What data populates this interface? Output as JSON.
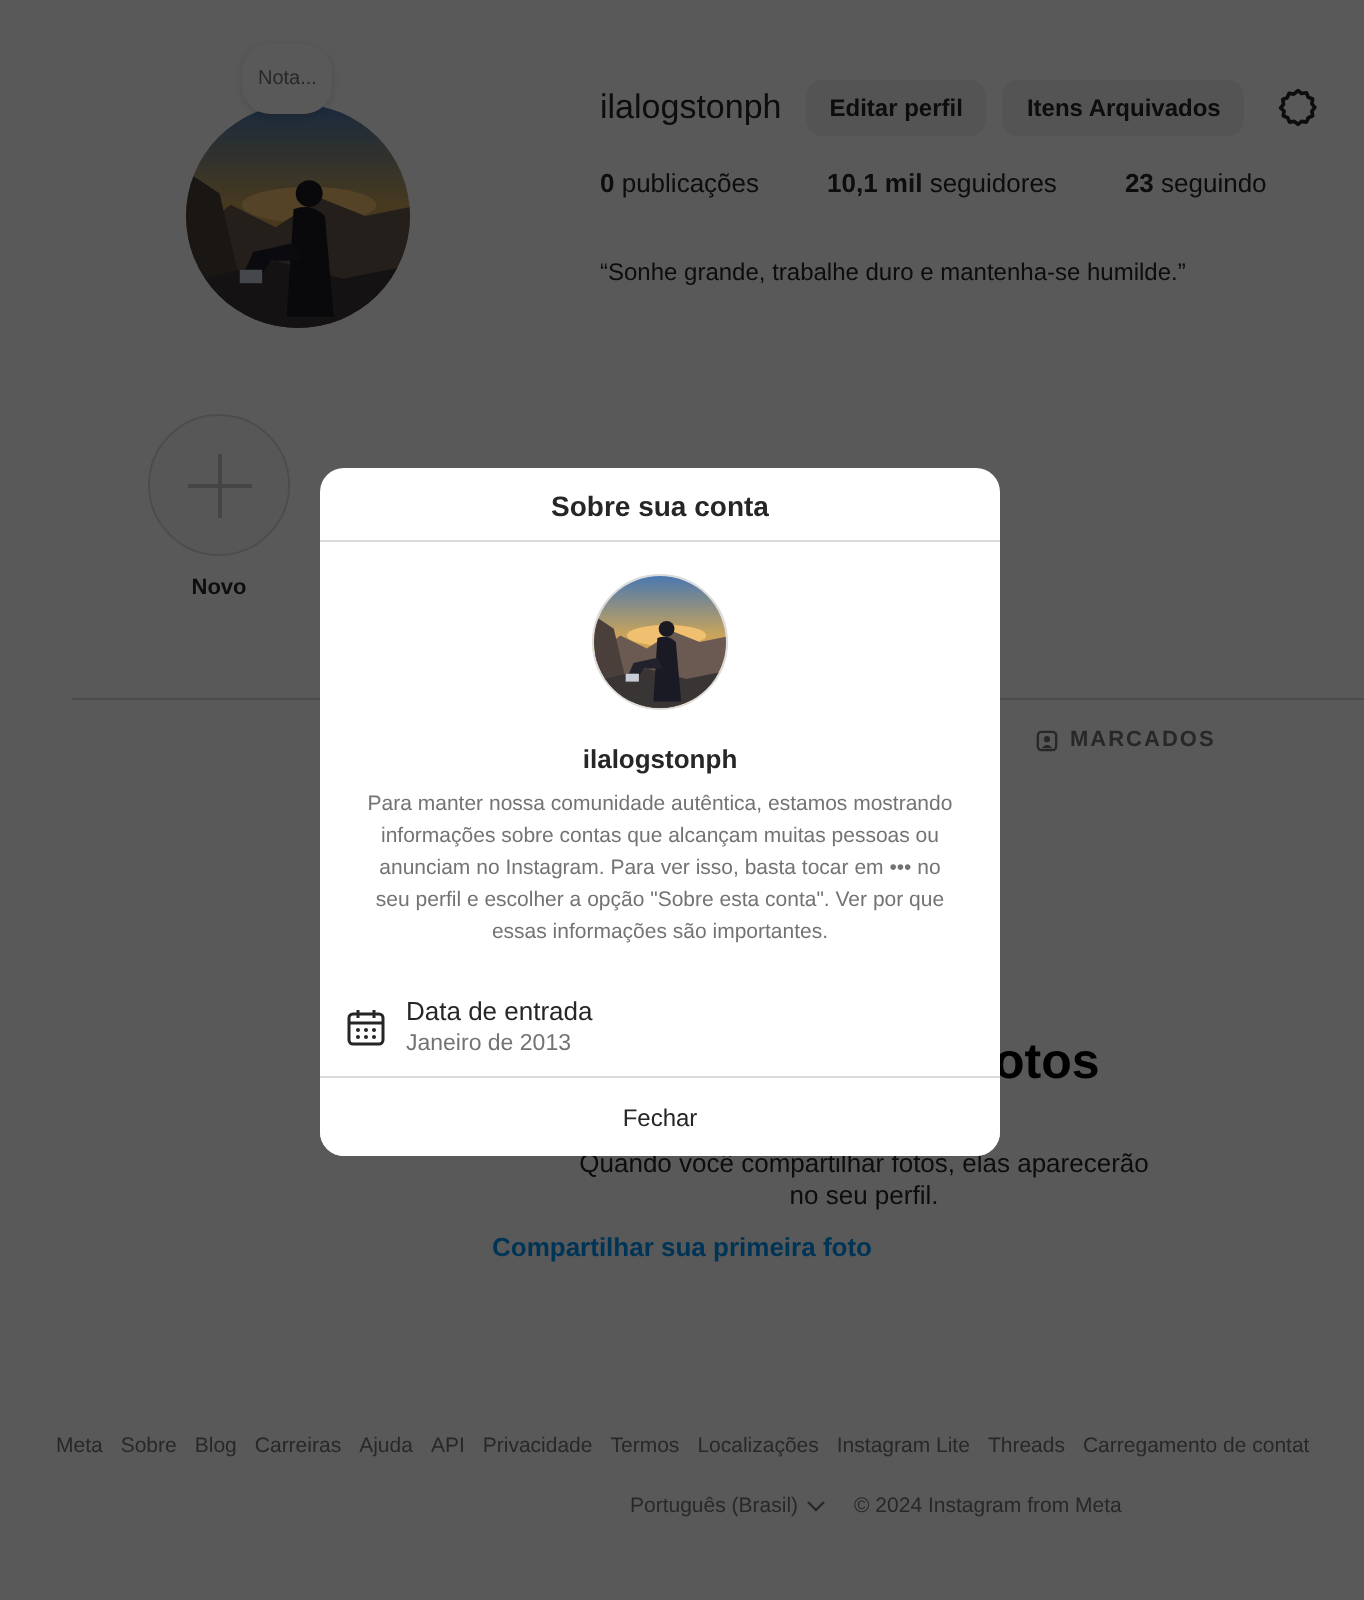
{
  "profile": {
    "note": "Nota...",
    "username": "ilalogstonph",
    "buttons": [
      "Editar perfil",
      "Itens Arquivados"
    ],
    "stats": [
      "**0** publicações",
      "**10,1 mil** seguidores",
      "**23** seguindo"
    ],
    "bio": "“Sonhe grande, trabalhe duro e mantenha-se humilde.”"
  },
  "highlights": [
    {
      "label": "Novo"
    }
  ],
  "tabs": [
    {
      "label": "MARCADOS"
    }
  ],
  "empty_state": {
    "title": "otos",
    "text": "Quando você compartilhar fotos, elas aparecerão no seu perfil.",
    "link": "Compartilhar sua primeira foto"
  },
  "footer": {
    "links": [
      "Meta",
      "Sobre",
      "Blog",
      "Carreiras",
      "Ajuda",
      "API",
      "Privacidade",
      "Termos",
      "Localizações",
      "Instagram Lite",
      "Threads",
      "Carregamento de contat"
    ],
    "language": "Português (Brasil)",
    "copyright": "© 2024 Instagram from Meta"
  },
  "dialog": {
    "title": "Sobre sua conta",
    "username": "ilalogstonph",
    "description": "Para manter nossa comunidade autêntica, estamos mostrando informações sobre contas que alcançam muitas pessoas ou anunciam no Instagram. Para ver isso, basta tocar em ••• no seu perfil e escolher a opção \"Sobre esta conta\". Ver por que essas informações são importantes.",
    "details": [
      {
        "label": "Data de entrada",
        "value": "Janeiro de 2013"
      }
    ],
    "close": "Fechar"
  }
}
